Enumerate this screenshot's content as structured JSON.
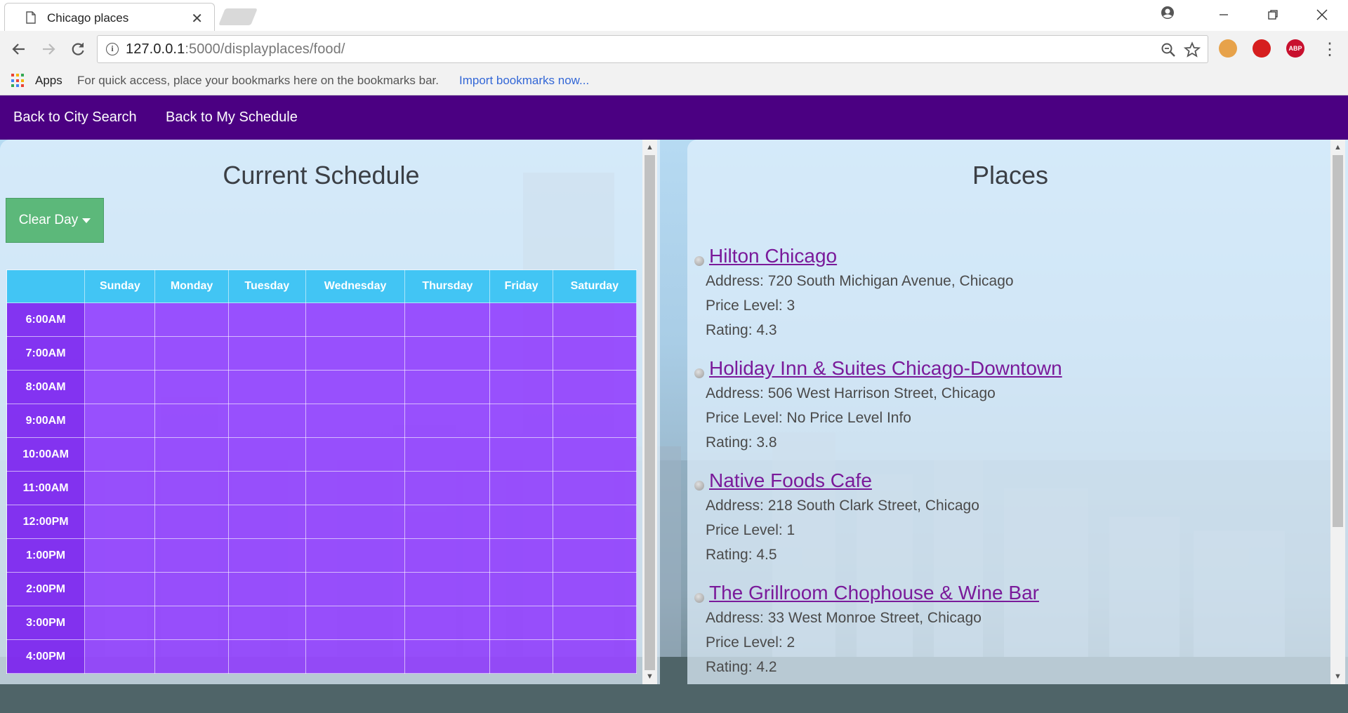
{
  "browser": {
    "tab_title": "Chicago places",
    "url_host": "127.0.0.1",
    "url_rest": ":5000/displayplaces/food/",
    "bookmarks_apps": "Apps",
    "bookmarks_hint": "For quick access, place your bookmarks here on the bookmarks bar.",
    "bookmarks_import": "Import bookmarks now..."
  },
  "nav": {
    "city_search": "Back to City Search",
    "my_schedule": "Back to My Schedule"
  },
  "schedule": {
    "title": "Current Schedule",
    "clear_label": "Clear Day",
    "days": [
      "Sunday",
      "Monday",
      "Tuesday",
      "Wednesday",
      "Thursday",
      "Friday",
      "Saturday"
    ],
    "times": [
      "6:00AM",
      "7:00AM",
      "8:00AM",
      "9:00AM",
      "10:00AM",
      "11:00AM",
      "12:00PM",
      "1:00PM",
      "2:00PM",
      "3:00PM",
      "4:00PM"
    ]
  },
  "places": {
    "title": "Places",
    "items": [
      {
        "name": "Hilton Chicago",
        "address": "Address: 720 South Michigan Avenue, Chicago",
        "price": "Price Level: 3",
        "rating": "Rating: 4.3"
      },
      {
        "name": "Holiday Inn & Suites Chicago-Downtown",
        "address": "Address: 506 West Harrison Street, Chicago",
        "price": "Price Level: No Price Level Info",
        "rating": "Rating: 3.8"
      },
      {
        "name": "Native Foods Cafe",
        "address": "Address: 218 South Clark Street, Chicago",
        "price": "Price Level: 1",
        "rating": "Rating: 4.5"
      },
      {
        "name": "The Grillroom Chophouse & Wine Bar",
        "address": "Address: 33 West Monroe Street, Chicago",
        "price": "Price Level: 2",
        "rating": "Rating: 4.2"
      }
    ]
  },
  "colors": {
    "nav_bg": "#4b0082",
    "table_header": "#42c5f4",
    "table_cell": "#8a2bff",
    "clear_button": "#5cb87a",
    "place_link": "#7a1a9a"
  }
}
